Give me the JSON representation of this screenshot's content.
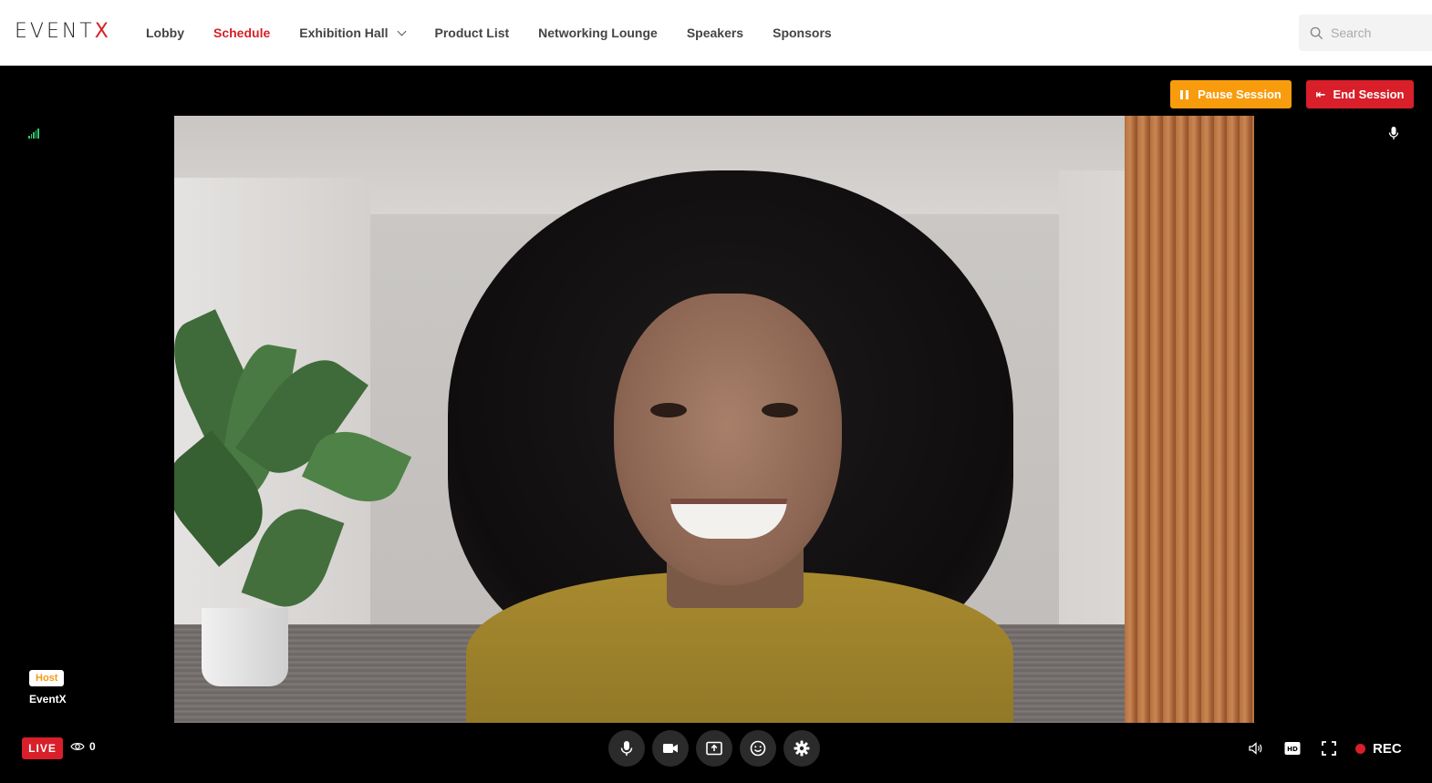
{
  "app": {
    "logo_text": "EVENT",
    "logo_accent": "X",
    "brand_color": "#d42027"
  },
  "nav": {
    "items": [
      {
        "label": "Lobby",
        "active": false
      },
      {
        "label": "Schedule",
        "active": true
      },
      {
        "label": "Exhibition Hall",
        "active": false,
        "has_dropdown": true
      },
      {
        "label": "Product List",
        "active": false
      },
      {
        "label": "Networking Lounge",
        "active": false
      },
      {
        "label": "Speakers",
        "active": false
      },
      {
        "label": "Sponsors",
        "active": false
      }
    ]
  },
  "search": {
    "placeholder": "Search"
  },
  "session": {
    "pause_label": "Pause Session",
    "end_label": "End Session",
    "pause_color": "#f89c0e",
    "end_color": "#d81f2a"
  },
  "participant": {
    "role": "Host",
    "name": "EventX"
  },
  "status": {
    "live_label": "LIVE",
    "viewer_count": "0",
    "rec_label": "REC"
  },
  "controls": {
    "icons": [
      "microphone-icon",
      "camera-icon",
      "share-screen-icon",
      "emoji-icon",
      "settings-icon"
    ]
  },
  "right_tools": {
    "icons": [
      "volume-icon",
      "hd-icon",
      "fullscreen-icon"
    ]
  }
}
